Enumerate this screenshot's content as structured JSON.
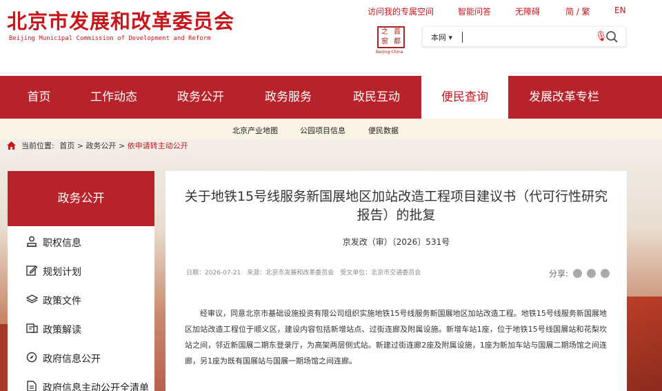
{
  "header": {
    "logo_cn": "北京市发展和改革委员会",
    "logo_en": "Beijing Municipal Commission of Development and Reform",
    "top_links": [
      "访问我的专属空间",
      "智能问答",
      "无障碍",
      "简 / 繁",
      "EN"
    ],
    "seal_chars": [
      "之",
      "首",
      "窗",
      "都"
    ],
    "seal_sub": "Beijing·China",
    "search_scope": "本网"
  },
  "nav": {
    "items": [
      "首页",
      "工作动态",
      "政务公开",
      "政务服务",
      "政民互动",
      "便民查询",
      "发展改革专栏"
    ],
    "active_index": 5
  },
  "subnav": {
    "items": [
      "北京产业地图",
      "公园项目信息",
      "便民数据"
    ]
  },
  "breadcrumb": {
    "label": "当前位置:",
    "home": "首页",
    "sep1": ">",
    "section": "政务公开",
    "sep2": ">",
    "current": "依申请转主动公开"
  },
  "sidebar": {
    "heading": "政务公开",
    "items": [
      {
        "label": "职权信息",
        "icon": "user-badge-icon"
      },
      {
        "label": "规划计划",
        "icon": "edit-icon"
      },
      {
        "label": "政策文件",
        "icon": "layers-icon"
      },
      {
        "label": "政策解读",
        "icon": "interpret-icon"
      },
      {
        "label": "政府信息公开",
        "icon": "compass-icon"
      },
      {
        "label": "政府信息主动公开全清单",
        "icon": "document-icon"
      }
    ]
  },
  "article": {
    "title": "关于地铁15号线服务新国展地区加站改造工程项目建议书（代可行性研究报告）的批复",
    "doc_number": "京发改（审）〔2026〕531号",
    "meta": "日期：2026-07-21　来源：北京市发展和改革委员会　受文单位：北京市交通委员会",
    "share_label": "分享:",
    "body": "经审议，同意北京市基础设施投资有限公司组织实施地铁15号线服务新国展地区加站改造工程。地铁15号线服务新国展地区加站改造工程位于顺义区，建设内容包括新增站点、过街连廊及附属设施。新增车站1座，位于地铁15号线国展站和花梨坎站之间，邻近新国展二期东登录厅，为高架两层侧式站。新建过街连廊2座及附属设施，1座为新加车站与国展二期场馆之间连廊，另1座为既有国展站与国展一期场馆之间连廊。"
  },
  "colors": {
    "brand_red": "#c8161d",
    "nav_red": "#b8232b",
    "subnav_bg": "#fbf3e4"
  }
}
